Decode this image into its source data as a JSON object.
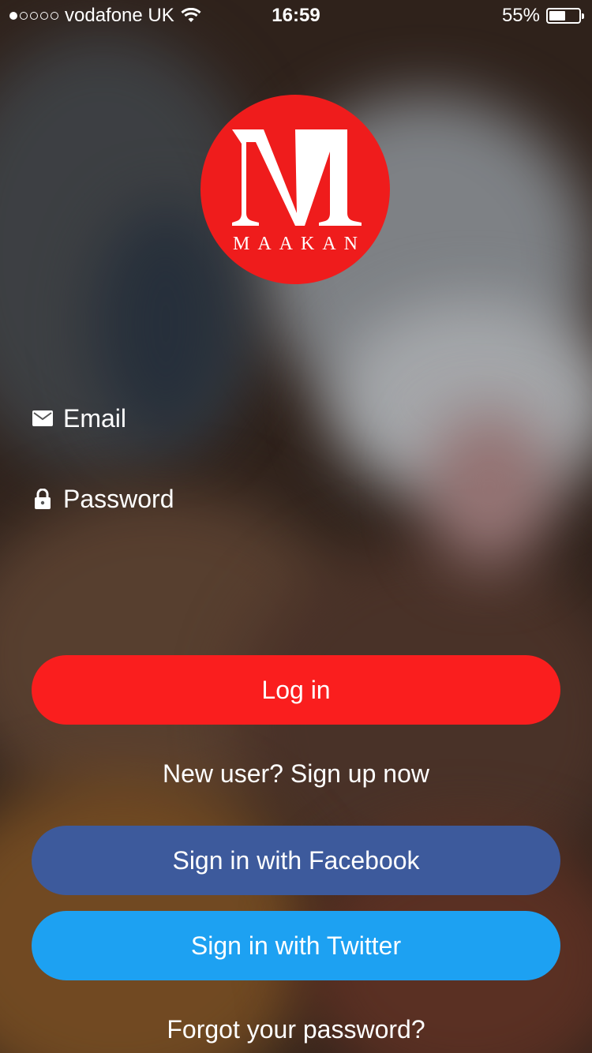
{
  "status_bar": {
    "carrier": "vodafone UK",
    "time": "16:59",
    "battery": "55%",
    "battery_level": 0.55,
    "signal_bars_filled": 1,
    "signal_bars_total": 5
  },
  "logo": {
    "letter": "M",
    "brand": "MAAKAN",
    "color": "#ef1c1c"
  },
  "form": {
    "email_placeholder": "Email",
    "password_placeholder": "Password",
    "email_icon": "mail-icon",
    "password_icon": "lock-icon"
  },
  "actions": {
    "login": "Log in",
    "signup": "New user? Sign up now",
    "facebook": "Sign in with Facebook",
    "twitter": "Sign in with Twitter",
    "forgot": "Forgot your password?"
  },
  "colors": {
    "login": "#fa1e1e",
    "facebook": "#3d5a9c",
    "twitter": "#1da1f2"
  }
}
